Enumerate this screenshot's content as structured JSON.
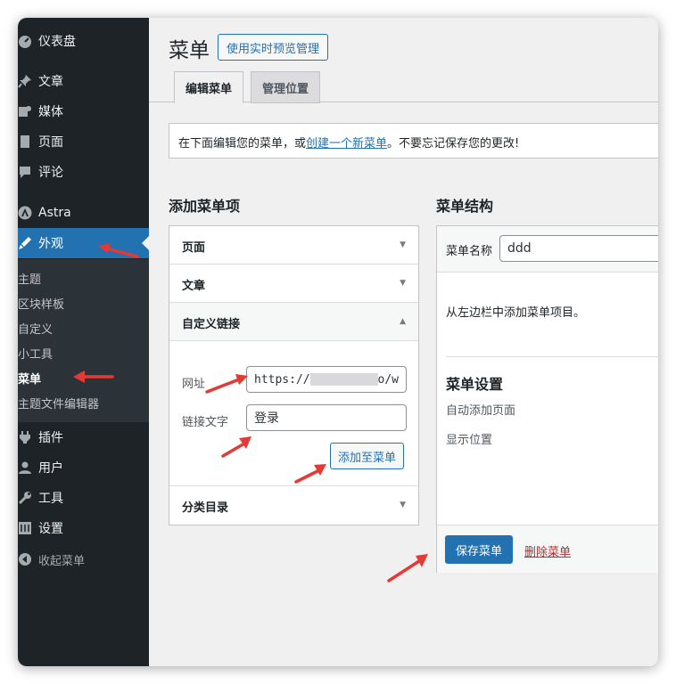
{
  "sidebar": {
    "items": [
      {
        "label": "仪表盘",
        "icon": "dashboard-icon"
      },
      {
        "label": "文章",
        "icon": "pin-icon"
      },
      {
        "label": "媒体",
        "icon": "media-icon"
      },
      {
        "label": "页面",
        "icon": "page-icon"
      },
      {
        "label": "评论",
        "icon": "comment-icon"
      },
      {
        "label": "Astra",
        "icon": "astra-icon"
      },
      {
        "label": "外观",
        "icon": "appearance-icon"
      },
      {
        "label": "插件",
        "icon": "plugin-icon"
      },
      {
        "label": "用户",
        "icon": "user-icon"
      },
      {
        "label": "工具",
        "icon": "wrench-icon"
      },
      {
        "label": "设置",
        "icon": "settings-icon"
      },
      {
        "label": "收起菜单",
        "icon": "collapse-icon"
      }
    ],
    "submenu": [
      "主题",
      "区块样板",
      "自定义",
      "小工具",
      "菜单",
      "主题文件编辑器"
    ],
    "current_item": "外观",
    "current_submenu": "菜单"
  },
  "header": {
    "title": "菜单",
    "live_preview_button": "使用实时预览管理"
  },
  "tabs": [
    {
      "label": "编辑菜单",
      "active": true
    },
    {
      "label": "管理位置",
      "active": false
    }
  ],
  "notice": {
    "prefix": "在下面编辑您的菜单，或",
    "link": "创建一个新菜单",
    "suffix": "。不要忘记保存您的更改!"
  },
  "add_items": {
    "heading": "添加菜单项",
    "sections": [
      {
        "label": "页面",
        "expanded": false
      },
      {
        "label": "文章",
        "expanded": false
      },
      {
        "label": "自定义链接",
        "expanded": true
      },
      {
        "label": "分类目录",
        "expanded": false
      }
    ],
    "custom_link": {
      "url_label": "网址",
      "url_value_start": "https://",
      "url_value_end": "o/w",
      "text_label": "链接文字",
      "text_value": "登录",
      "add_button": "添加至菜单"
    }
  },
  "structure": {
    "heading": "菜单结构",
    "name_label": "菜单名称",
    "name_value": "ddd",
    "instructions": "从左边栏中添加菜单项目。",
    "settings_heading": "菜单设置",
    "auto_add_label": "自动添加页面",
    "location_label": "显示位置",
    "save_button": "保存菜单",
    "delete_link": "删除菜单"
  },
  "colors": {
    "sidebar_bg": "#1d2327",
    "accent": "#2271b1",
    "danger": "#b32d2e",
    "annotation_arrow": "#e53935"
  }
}
